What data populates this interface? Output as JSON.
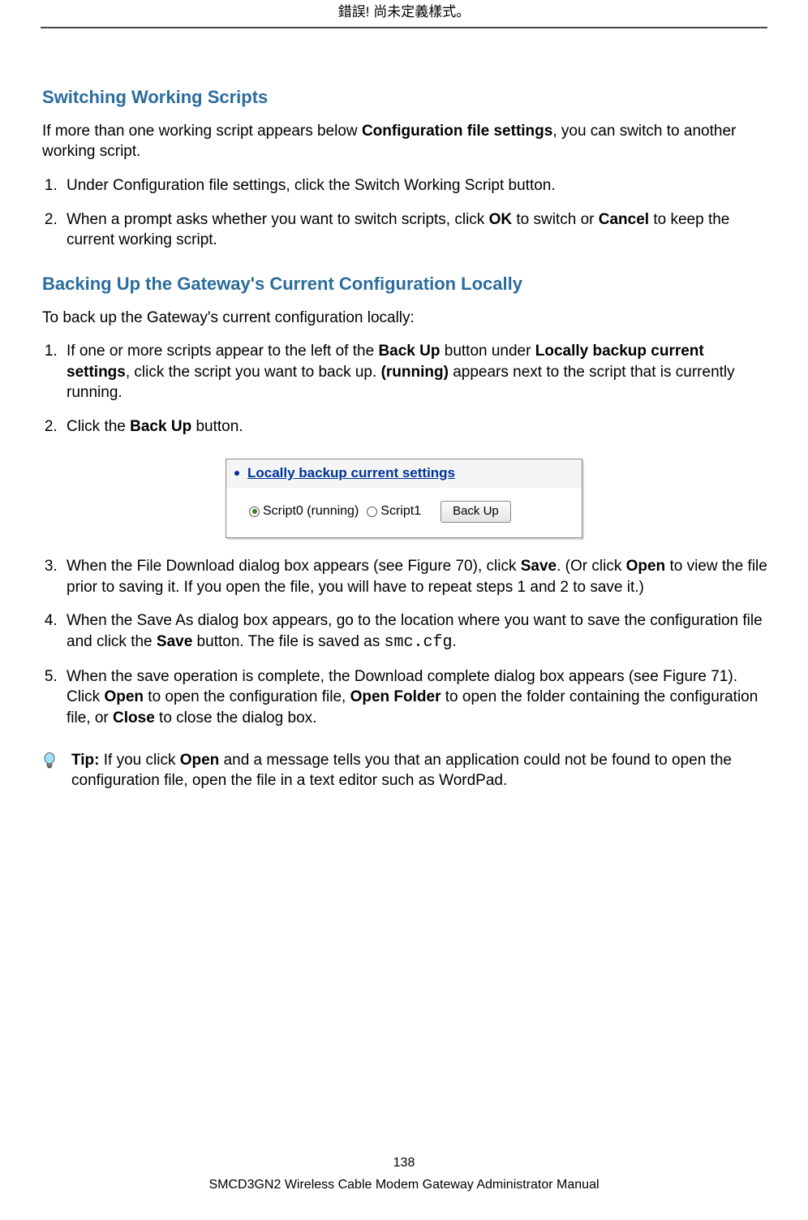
{
  "header": "錯誤! 尚未定義樣式。",
  "section1": {
    "title": "Switching Working Scripts",
    "intro_pre": "If more than one working script appears below ",
    "intro_bold": "Configuration file settings",
    "intro_post": ", you can switch to another working script.",
    "step1": "Under Configuration file settings, click the Switch Working Script button.",
    "step2_pre": "When a prompt asks whether you want to switch scripts, click ",
    "ok": "OK",
    "step2_mid": " to switch or ",
    "cancel": "Cancel",
    "step2_post": " to keep the current working script."
  },
  "section2": {
    "title": "Backing Up the Gateway's Current Configuration Locally",
    "intro": "To back up the Gateway's current configuration locally:",
    "s1_a": "If one or more scripts appear to the left of the ",
    "s1_b": "Back Up",
    "s1_c": " button under ",
    "s1_d": "Locally backup current settings",
    "s1_e": ", click the script you want to back up. ",
    "s1_f": "(running)",
    "s1_g": " appears next to the script that is currently running.",
    "s2_a": "Click the ",
    "s2_b": "Back Up",
    "s2_c": " button.",
    "s3_a": "When the File Download dialog box appears (see Figure 70), click ",
    "s3_save": "Save",
    "s3_b": ". (Or click ",
    "s3_open": "Open",
    "s3_c": " to view the file prior to saving it. If you open the file, you will have to repeat steps 1 and 2 to save it.)",
    "s4_a": "When the Save As dialog box appears, go to the location where you want to save the configuration file and click the ",
    "s4_save": "Save",
    "s4_b": " button. The file is saved as ",
    "s4_file": "smc.cfg",
    "s4_c": ".",
    "s5_a": "When the save operation is complete, the Download complete dialog box appears (see Figure 71). Click ",
    "s5_open": "Open",
    "s5_b": " to open the configuration file, ",
    "s5_of": "Open Folder",
    "s5_c": " to open the folder containing the configuration file, or ",
    "s5_close": "Close",
    "s5_d": " to close the dialog box."
  },
  "figure": {
    "title": "Locally backup current settings",
    "script0": "Script0 (running)",
    "script1": "Script1",
    "button": "Back Up"
  },
  "tip": {
    "label": "Tip:",
    "a": " If you click ",
    "open": "Open",
    "b": " and a message tells you that an application could not be found to open the configuration file, open the file in a text editor such as WordPad."
  },
  "footer": {
    "page": "138",
    "title": "SMCD3GN2 Wireless Cable Modem Gateway Administrator Manual"
  }
}
